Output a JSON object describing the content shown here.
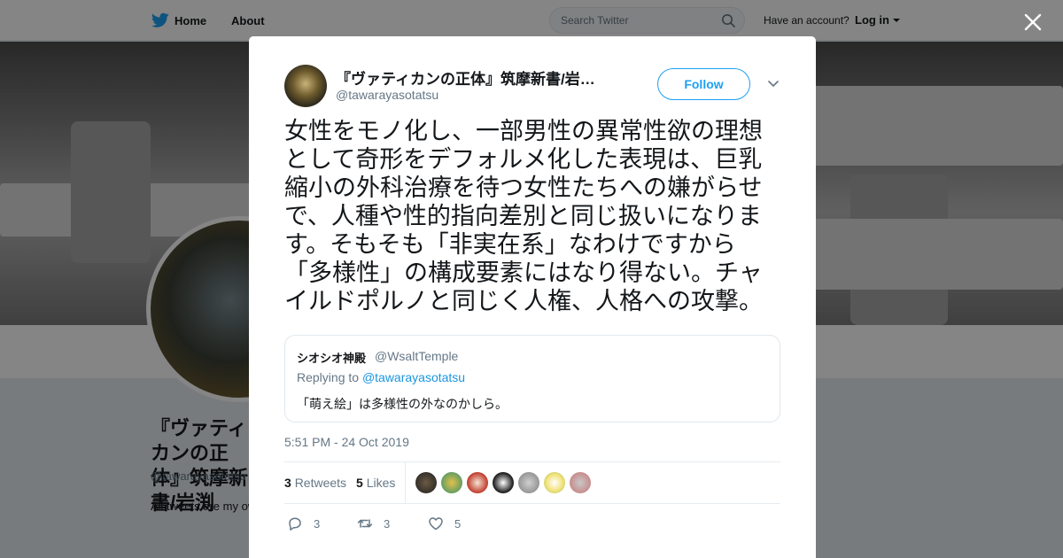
{
  "nav": {
    "home_label": "Home",
    "about_label": "About",
    "search_placeholder": "Search Twitter",
    "have_account": "Have an account?",
    "login_label": "Log in"
  },
  "profile_background": {
    "name": "『ヴァティカンの正体』筑摩新書/岩渕",
    "handle": "@tawarayasotatsu",
    "bio": "All tweets are my own and do not represent any of my affiliations. : info@ Junko IWABUCHI"
  },
  "tweet": {
    "author_name": "『ヴァティカンの正体』筑摩新書/岩…",
    "author_handle": "@tawarayasotatsu",
    "follow_label": "Follow",
    "text": "女性をモノ化し、一部男性の異常性欲の理想として奇形をデフォルメ化した表現は、巨乳縮小の外科治療を待つ女性たちへの嫌がらせで、人種や性的指向差別と同じ扱いになります。そもそも「非実在系」なわけですから「多様性」の構成要素にはなり得ない。チャイルドポルノと同じく人権、人格への攻撃。",
    "quoted": {
      "name": "シオシオ神殿",
      "handle": "@WsaltTemple",
      "replying_prefix": "Replying to",
      "replying_handle": "@tawarayasotatsu",
      "text": "「萌え絵」は多様性の外なのかしら。"
    },
    "timestamp": "5:51 PM - 24 Oct 2019",
    "retweets_count": "3",
    "retweets_label": "Retweets",
    "likes_count": "5",
    "likes_label": "Likes",
    "reply_count": "3",
    "retweet_action_count": "3",
    "like_action_count": "5"
  },
  "colors": {
    "accent": "#1da1f2",
    "text": "#14171a",
    "muted": "#657786"
  }
}
